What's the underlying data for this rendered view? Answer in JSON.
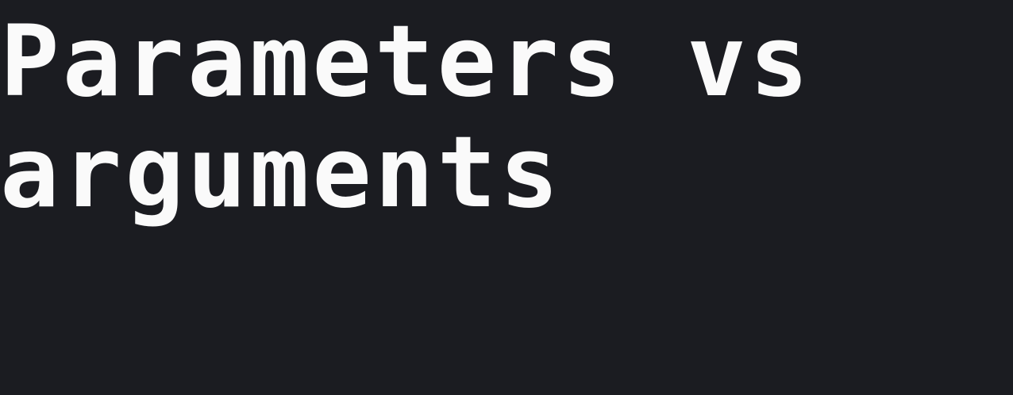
{
  "slide": {
    "title_lines": [
      "Parameters vs",
      "arguments"
    ]
  },
  "colors": {
    "background": "#1b1c21",
    "text": "#fafafa"
  }
}
